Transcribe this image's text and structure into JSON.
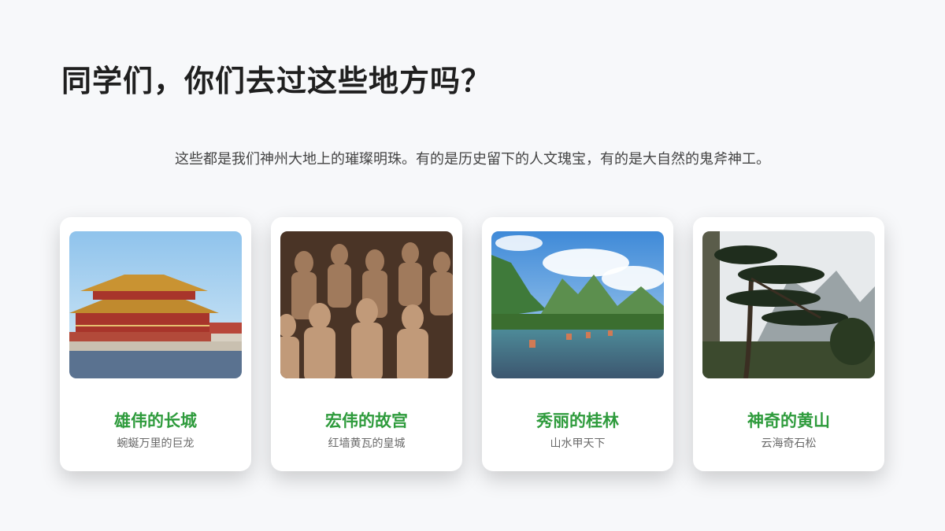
{
  "title": "同学们，你们去过这些地方吗？",
  "subtitle": "这些都是我们神州大地上的璀璨明珠。有的是历史留下的人文瑰宝，有的是大自然的鬼斧神工。",
  "accent_color": "#2e9b3c",
  "cards": [
    {
      "title": "雄伟的长城",
      "subtitle": "蜿蜒万里的巨龙",
      "image": "palace-photo"
    },
    {
      "title": "宏伟的故宫",
      "subtitle": "红墙黄瓦的皇城",
      "image": "terracotta-warriors-photo"
    },
    {
      "title": "秀丽的桂林",
      "subtitle": "山水甲天下",
      "image": "guilin-river-photo"
    },
    {
      "title": "神奇的黄山",
      "subtitle": "云海奇石松",
      "image": "huangshan-pine-photo"
    }
  ]
}
